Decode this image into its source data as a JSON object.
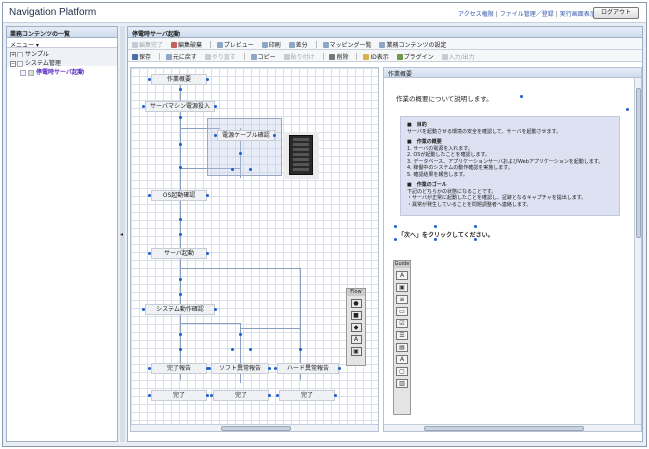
{
  "app": {
    "title": "Navigation Platform"
  },
  "header_links": {
    "access": "アクセス権限",
    "file_manage": "ファイル管理／登録",
    "run_screen": "実行画面表示",
    "logout": "ログアウト",
    "sep": "|"
  },
  "left_panel": {
    "title": "業務コンテンツの一覧",
    "menu": "メニュー ▾",
    "tree": [
      {
        "toggle": "+",
        "label": "サンプル"
      },
      {
        "toggle": "−",
        "label": "システム管理"
      },
      {
        "toggle": "",
        "label": "停電時サーバ起動"
      }
    ]
  },
  "splitter": {
    "arrow": "◂"
  },
  "main": {
    "title": "停電時サーバ起動",
    "toolbar1": [
      {
        "label": "編集完了",
        "enabled": false
      },
      {
        "label": "編集破棄",
        "enabled": true
      },
      {
        "label": "プレビュー",
        "enabled": true
      },
      {
        "label": "印刷",
        "enabled": true
      },
      {
        "label": "差分",
        "enabled": true
      },
      {
        "label": "マッピング一覧",
        "enabled": true
      },
      {
        "label": "業務コンテンツの設定",
        "enabled": true
      }
    ],
    "toolbar2": [
      {
        "label": "保存",
        "enabled": true
      },
      {
        "label": "元に戻す",
        "enabled": true
      },
      {
        "label": "やり直す",
        "enabled": false
      },
      {
        "label": "コピー",
        "enabled": true
      },
      {
        "label": "貼り付け",
        "enabled": false
      },
      {
        "label": "削除",
        "enabled": true
      },
      {
        "label": "ID表示",
        "enabled": true
      },
      {
        "label": "プラグイン",
        "enabled": true
      },
      {
        "label": "入力/出力",
        "enabled": false
      }
    ]
  },
  "flow": {
    "nodes": [
      {
        "label": "作業概要"
      },
      {
        "label": "サーバマシン電源投入"
      },
      {
        "label": "電源ケーブル確認"
      },
      {
        "label": "OS起動確認"
      },
      {
        "label": "サーバ起動"
      },
      {
        "label": "システム動作確認"
      },
      {
        "label": "完了報告"
      },
      {
        "label": "ソフト異常報告"
      },
      {
        "label": "ハード異常報告"
      },
      {
        "label": "完了"
      },
      {
        "label": "完了"
      },
      {
        "label": "完了"
      }
    ],
    "palette_title": "Flow",
    "palette_icons": [
      "circle-icon",
      "square-icon",
      "diamond-icon",
      "text-icon",
      "image-icon"
    ],
    "palette_glyphs": [
      "●",
      "■",
      "◆",
      "A",
      "▣"
    ]
  },
  "work": {
    "title": "作業概要",
    "summary": "作業の概要について説明します。",
    "box_lines": [
      {
        "text": "■　目的",
        "head": true
      },
      {
        "text": "サーバを起動させる環境の安全を確認して、サーバを起動させます。",
        "head": false
      },
      {
        "text": "",
        "head": false
      },
      {
        "text": "■　作業の概要",
        "head": true
      },
      {
        "text": "1. サーバの電源を入れます。",
        "head": false
      },
      {
        "text": "2. OSが起動したことを確認します。",
        "head": false
      },
      {
        "text": "3. データベース、アプリケーションサーバおよびWebアプリケーションを起動します。",
        "head": false
      },
      {
        "text": "4. 稼働中のシステムの動作確認を実施します。",
        "head": false
      },
      {
        "text": "5. 確認結果を報告します。",
        "head": false
      },
      {
        "text": "",
        "head": false
      },
      {
        "text": "■　作業のゴール",
        "head": true
      },
      {
        "text": "下記のどちらかの状態になることです。",
        "head": false
      },
      {
        "text": "・サーバが正常に起動したことを確認し、証跡となるキャプチャを提出します。",
        "head": false
      },
      {
        "text": "・異常が発生していることを問題調整者へ連絡します。",
        "head": false
      }
    ],
    "next_prompt": "「次へ」をクリックしてください。",
    "guide_title": "Guide",
    "guide_icons": [
      "text-icon",
      "image-icon",
      "list-icon",
      "input-icon",
      "checkbox-icon",
      "radio-list-icon",
      "table-icon",
      "font-icon",
      "frame-icon",
      "window-icon"
    ],
    "guide_glyphs": [
      "A",
      "▣",
      "≡",
      "▭",
      "☑",
      "☰",
      "▤",
      "A",
      "▢",
      "▥"
    ]
  }
}
